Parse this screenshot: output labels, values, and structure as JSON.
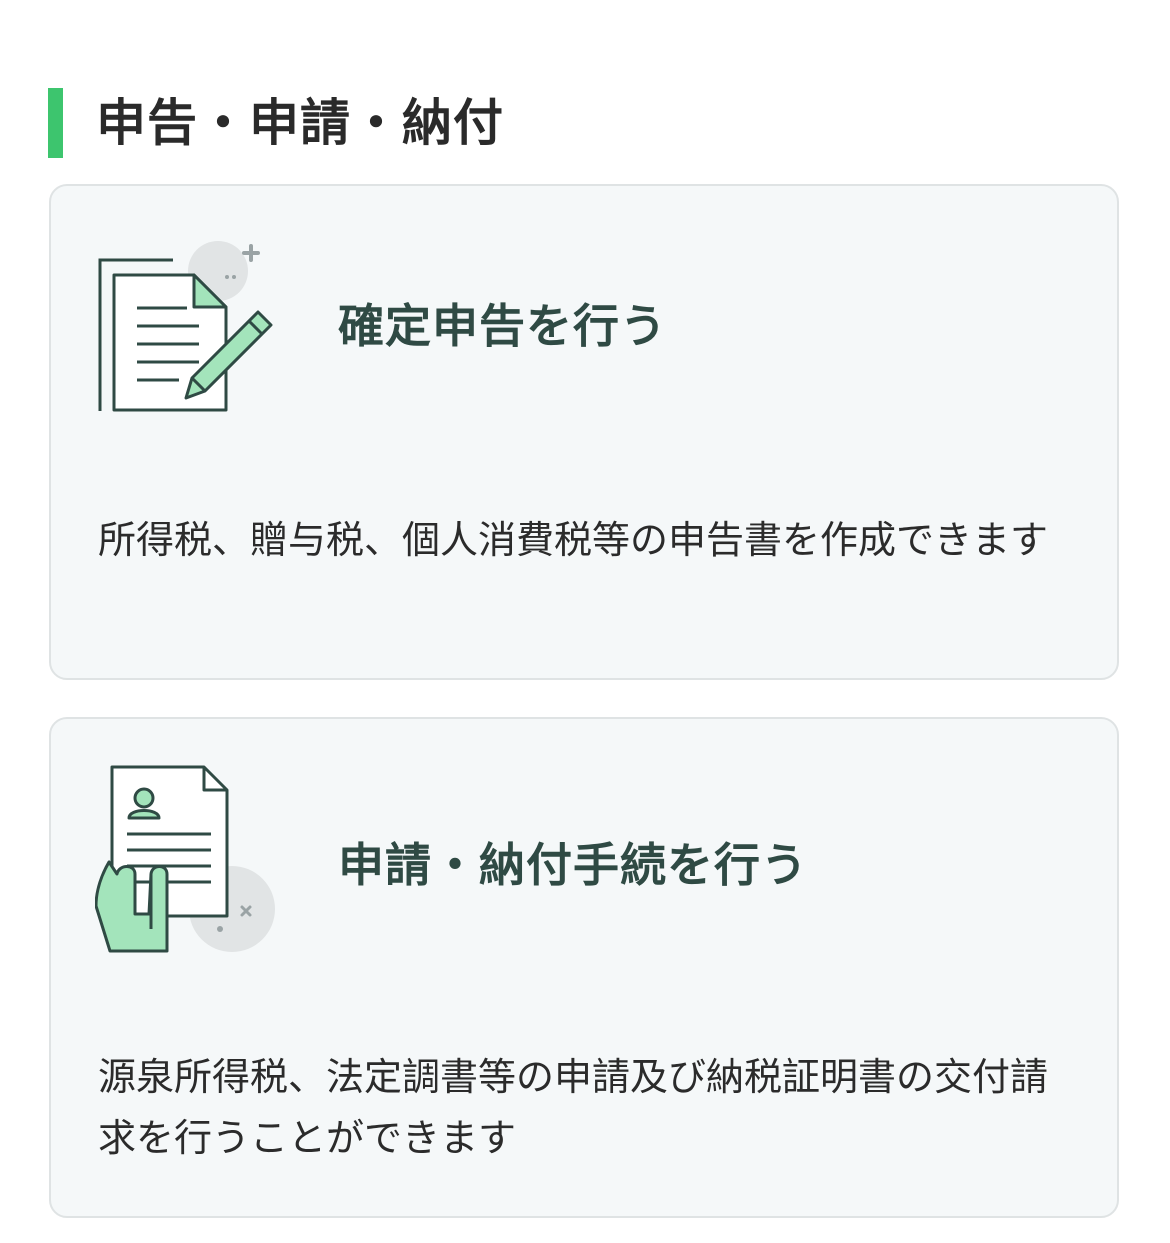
{
  "section": {
    "title": "申告・申請・納付"
  },
  "cards": [
    {
      "icon": "document-pen-icon",
      "title": "確定申告を行う",
      "description": "所得税、贈与税、個人消費税等の申告書を作成できます"
    },
    {
      "icon": "hand-holding-document-icon",
      "title": "申請・納付手続を行う",
      "description": "源泉所得税、法定調書等の申請及び納税証明書の交付請求を行うことができます"
    }
  ],
  "colors": {
    "accent": "#3dc56e",
    "card_background": "#f5f8f9",
    "card_border": "#dfe3e4",
    "title_text": "#2f4a44",
    "icon_stroke": "#2f4a44",
    "icon_fill_green": "#a3e4bb"
  }
}
